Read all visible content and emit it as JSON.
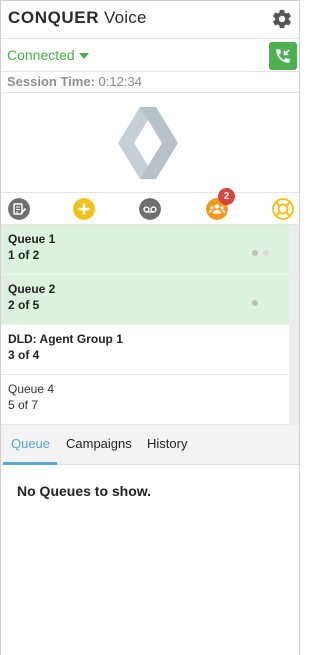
{
  "app": {
    "brand_bold": "CONQUER",
    "brand_light": "Voice"
  },
  "status": {
    "label": "Connected",
    "color": "#49b04b"
  },
  "session": {
    "label": "Session Time:",
    "value": "0:12:34"
  },
  "toolbar": {
    "icons": [
      "disposition-icon",
      "add-icon",
      "voicemail-icon",
      "agents-icon",
      "help-icon"
    ],
    "agents_badge": "2"
  },
  "queues": [
    {
      "name": "Queue 1",
      "count": "1 of 2",
      "active": true
    },
    {
      "name": "Queue 2",
      "count": "2 of 5",
      "active": true
    },
    {
      "name": "DLD: Agent Group 1",
      "count": "3 of 4",
      "active": false
    },
    {
      "name": "Queue 4",
      "count": "5 of 7",
      "active": false
    }
  ],
  "tabs": [
    {
      "label": "Queue",
      "active": true
    },
    {
      "label": "Campaigns",
      "active": false
    },
    {
      "label": "History",
      "active": false
    }
  ],
  "panel": {
    "empty_message": "No Queues to show."
  },
  "colors": {
    "accent_green": "#4caf50",
    "tab_blue": "#5aa7d3",
    "badge_red": "#d64541",
    "icon_yellow": "#f4c21a",
    "icon_orange": "#f39a1c",
    "icon_gray": "#6f6f6f"
  }
}
